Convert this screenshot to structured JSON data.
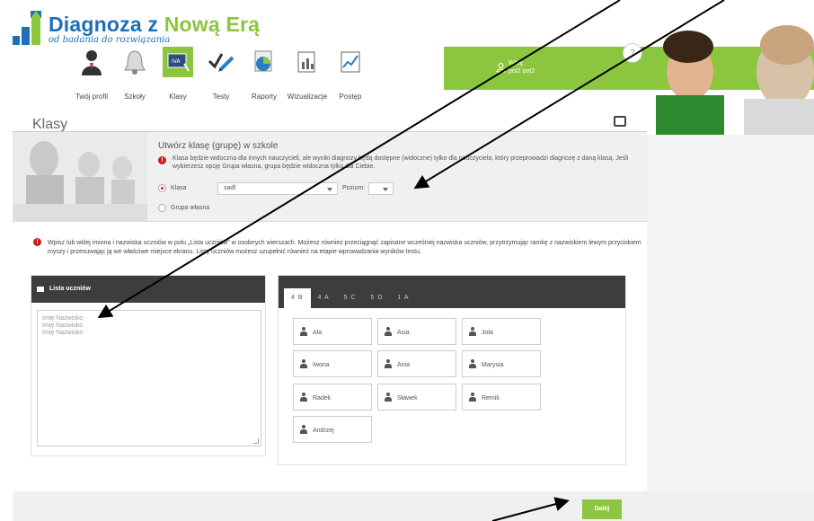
{
  "brand": {
    "title_part1": "Diagnoza z ",
    "title_part2": "Nową Erą",
    "subtitle": "od badania do rozwiązania"
  },
  "nav": {
    "items": [
      {
        "label": "Twój profil",
        "icon": "profile-icon"
      },
      {
        "label": "Szkoły",
        "icon": "bell-icon"
      },
      {
        "label": "Klasy",
        "icon": "class-icon",
        "active": true
      },
      {
        "label": "Testy",
        "icon": "test-icon"
      },
      {
        "label": "Raporty",
        "icon": "report-icon"
      },
      {
        "label": "Wizualizacje",
        "icon": "chart-icon"
      },
      {
        "label": "Postęp",
        "icon": "progress-icon"
      }
    ]
  },
  "user": {
    "greeting": "Witaj",
    "name": "pot2 pot2"
  },
  "help": {
    "label": "?"
  },
  "page": {
    "title": "Klasy"
  },
  "create_class": {
    "title": "Utwórz klasę (grupę) w szkole",
    "info": "Klasa będzie widoczna dla innych nauczycieli, ale wyniki diagnozy będą dostępne (widoczne) tylko dla nauczyciela, który przeprowadzi diagnozę z daną klasą. Jeśli wybierzesz opcję Grupa własna, grupa będzie widoczna tylko dla Ciebie.",
    "radio_class_label": "Klasa",
    "class_select_value": "sadf",
    "level_label": "Poziom:",
    "level_select_value": "",
    "radio_group_label": "Grupa własna"
  },
  "instructions": "Wpisz lub wklej imiona i nazwiska uczniów w polu „Lista uczniów” w osobnych wierszach. Możesz również przeciągnąć zapisane wcześniej nazwiska uczniów, przytrzymując ramkę z nazwiskiem lewym przyciskiem myszy i przesuwając ją we właściwe miejsce ekranu. Listę uczniów możesz uzupełnić również na etapie wprowadzania wyników testu.",
  "student_list": {
    "header": "Lista uczniów",
    "placeholder_lines": [
      "Imię Nazwisko",
      "Imię Nazwisko",
      "Imię Nazwisko"
    ]
  },
  "class_tabs": [
    "4 B",
    "4 A",
    "5 C",
    "5 D",
    "1 A"
  ],
  "students": [
    "Ala",
    "Asia",
    "Jola",
    "Iwona",
    "Ania",
    "Marysia",
    "Radek",
    "Sławek",
    "Remik",
    "Andrzej"
  ],
  "footer": {
    "next_label": "Dalej"
  },
  "colors": {
    "accent_green": "#8cc63f",
    "brand_blue": "#1d6fb8",
    "dark_header": "#3d3d3d",
    "warning_red": "#cc1b1b"
  }
}
